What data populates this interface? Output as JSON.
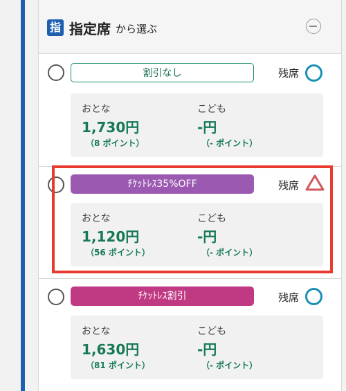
{
  "header": {
    "badge": "指",
    "title": "指定席",
    "subtitle": "から選ぶ",
    "collapse_icon": "minus-circle-icon"
  },
  "options": [
    {
      "label": "割引なし",
      "availability_label": "残席",
      "availability_icon": "circle-icon",
      "availability_color": "#1a8fb5",
      "adult_label": "おとな",
      "adult_price": "1,730円",
      "adult_points": "（8 ポイント）",
      "child_label": "こども",
      "child_price": "-円",
      "child_points": "（- ポイント）"
    },
    {
      "label": "ﾁｹｯﾄﾚｽ35%OFF",
      "availability_label": "残席",
      "availability_icon": "triangle-icon",
      "availability_color": "#d0565c",
      "adult_label": "おとな",
      "adult_price": "1,120円",
      "adult_points": "（56 ポイント）",
      "child_label": "こども",
      "child_price": "-円",
      "child_points": "（- ポイント）"
    },
    {
      "label": "ﾁｹｯﾄﾚｽ割引",
      "availability_label": "残席",
      "availability_icon": "circle-icon",
      "availability_color": "#1a8fb5",
      "adult_label": "おとな",
      "adult_price": "1,630円",
      "adult_points": "（81 ポイント）",
      "child_label": "こども",
      "child_price": "-円",
      "child_points": "（- ポイント）"
    }
  ],
  "colors": {
    "accent_blue": "#1f5fb0",
    "price_green": "#177a55",
    "highlight_red": "#e83a2f"
  }
}
